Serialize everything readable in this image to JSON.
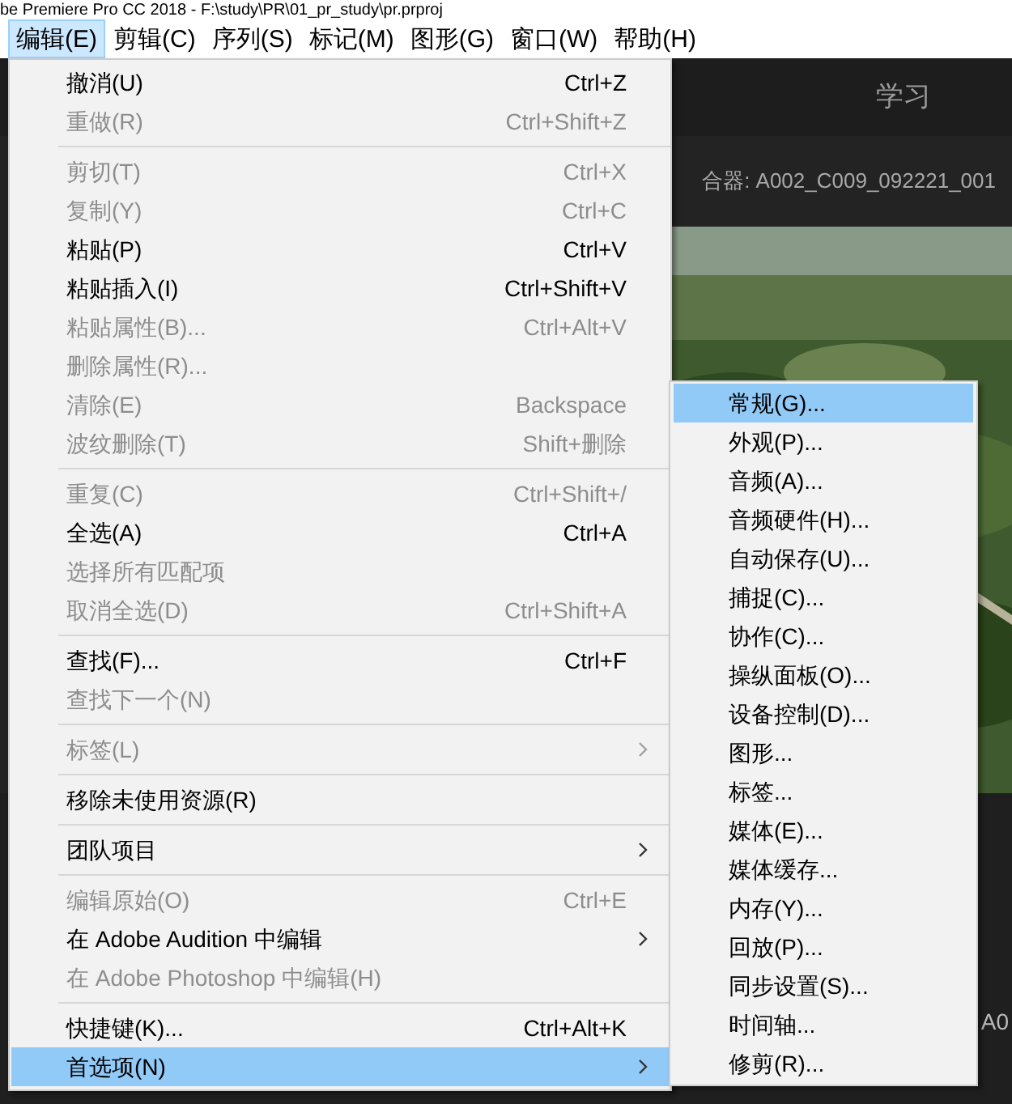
{
  "window": {
    "title": "be Premiere Pro CC 2018 - F:\\study\\PR\\01_pr_study\\pr.prproj"
  },
  "menubar": [
    {
      "label": "编辑(E)",
      "selected": true
    },
    {
      "label": "剪辑(C)",
      "selected": false
    },
    {
      "label": "序列(S)",
      "selected": false
    },
    {
      "label": "标记(M)",
      "selected": false
    },
    {
      "label": "图形(G)",
      "selected": false
    },
    {
      "label": "窗口(W)",
      "selected": false
    },
    {
      "label": "帮助(H)",
      "selected": false
    }
  ],
  "background": {
    "workspace_tab": "学习",
    "source_label": "合器: A002_C009_092221_001",
    "timeline_label": "A0"
  },
  "edit_menu": [
    {
      "kind": "item",
      "label": "撤消(U)",
      "shortcut": "Ctrl+Z",
      "disabled": false,
      "submenu": false,
      "selected": false
    },
    {
      "kind": "item",
      "label": "重做(R)",
      "shortcut": "Ctrl+Shift+Z",
      "disabled": true,
      "submenu": false,
      "selected": false
    },
    {
      "kind": "separator"
    },
    {
      "kind": "item",
      "label": "剪切(T)",
      "shortcut": "Ctrl+X",
      "disabled": true,
      "submenu": false,
      "selected": false
    },
    {
      "kind": "item",
      "label": "复制(Y)",
      "shortcut": "Ctrl+C",
      "disabled": true,
      "submenu": false,
      "selected": false
    },
    {
      "kind": "item",
      "label": "粘贴(P)",
      "shortcut": "Ctrl+V",
      "disabled": false,
      "submenu": false,
      "selected": false
    },
    {
      "kind": "item",
      "label": "粘贴插入(I)",
      "shortcut": "Ctrl+Shift+V",
      "disabled": false,
      "submenu": false,
      "selected": false
    },
    {
      "kind": "item",
      "label": "粘贴属性(B)...",
      "shortcut": "Ctrl+Alt+V",
      "disabled": true,
      "submenu": false,
      "selected": false
    },
    {
      "kind": "item",
      "label": "删除属性(R)...",
      "disabled": true,
      "submenu": false,
      "selected": false
    },
    {
      "kind": "item",
      "label": "清除(E)",
      "shortcut": "Backspace",
      "disabled": true,
      "submenu": false,
      "selected": false
    },
    {
      "kind": "item",
      "label": "波纹删除(T)",
      "shortcut": "Shift+删除",
      "disabled": true,
      "submenu": false,
      "selected": false
    },
    {
      "kind": "separator"
    },
    {
      "kind": "item",
      "label": "重复(C)",
      "shortcut": "Ctrl+Shift+/",
      "disabled": true,
      "submenu": false,
      "selected": false
    },
    {
      "kind": "item",
      "label": "全选(A)",
      "shortcut": "Ctrl+A",
      "disabled": false,
      "submenu": false,
      "selected": false
    },
    {
      "kind": "item",
      "label": "选择所有匹配项",
      "disabled": true,
      "submenu": false,
      "selected": false
    },
    {
      "kind": "item",
      "label": "取消全选(D)",
      "shortcut": "Ctrl+Shift+A",
      "disabled": true,
      "submenu": false,
      "selected": false
    },
    {
      "kind": "separator"
    },
    {
      "kind": "item",
      "label": "查找(F)...",
      "shortcut": "Ctrl+F",
      "disabled": false,
      "submenu": false,
      "selected": false
    },
    {
      "kind": "item",
      "label": "查找下一个(N)",
      "disabled": true,
      "submenu": false,
      "selected": false
    },
    {
      "kind": "separator"
    },
    {
      "kind": "item",
      "label": "标签(L)",
      "disabled": true,
      "submenu": true,
      "selected": false
    },
    {
      "kind": "separator"
    },
    {
      "kind": "item",
      "label": "移除未使用资源(R)",
      "disabled": false,
      "submenu": false,
      "selected": false
    },
    {
      "kind": "separator"
    },
    {
      "kind": "item",
      "label": "团队项目",
      "disabled": false,
      "submenu": true,
      "selected": false
    },
    {
      "kind": "separator"
    },
    {
      "kind": "item",
      "label": "编辑原始(O)",
      "shortcut": "Ctrl+E",
      "disabled": true,
      "submenu": false,
      "selected": false
    },
    {
      "kind": "item",
      "label": "在 Adobe Audition 中编辑",
      "disabled": false,
      "submenu": true,
      "selected": false
    },
    {
      "kind": "item",
      "label": "在 Adobe Photoshop 中编辑(H)",
      "disabled": true,
      "submenu": false,
      "selected": false
    },
    {
      "kind": "separator"
    },
    {
      "kind": "item",
      "label": "快捷键(K)...",
      "shortcut": "Ctrl+Alt+K",
      "disabled": false,
      "submenu": false,
      "selected": false
    },
    {
      "kind": "item",
      "label": "首选项(N)",
      "disabled": false,
      "submenu": true,
      "selected": true
    }
  ],
  "preferences_submenu": [
    {
      "label": "常规(G)...",
      "selected": true
    },
    {
      "label": "外观(P)...",
      "selected": false
    },
    {
      "label": "音频(A)...",
      "selected": false
    },
    {
      "label": "音频硬件(H)...",
      "selected": false
    },
    {
      "label": "自动保存(U)...",
      "selected": false
    },
    {
      "label": "捕捉(C)...",
      "selected": false
    },
    {
      "label": "协作(C)...",
      "selected": false
    },
    {
      "label": "操纵面板(O)...",
      "selected": false
    },
    {
      "label": "设备控制(D)...",
      "selected": false
    },
    {
      "label": "图形...",
      "selected": false
    },
    {
      "label": "标签...",
      "selected": false
    },
    {
      "label": "媒体(E)...",
      "selected": false
    },
    {
      "label": "媒体缓存...",
      "selected": false
    },
    {
      "label": "内存(Y)...",
      "selected": false
    },
    {
      "label": "回放(P)...",
      "selected": false
    },
    {
      "label": "同步设置(S)...",
      "selected": false
    },
    {
      "label": "时间轴...",
      "selected": false
    },
    {
      "label": "修剪(R)...",
      "selected": false
    }
  ]
}
